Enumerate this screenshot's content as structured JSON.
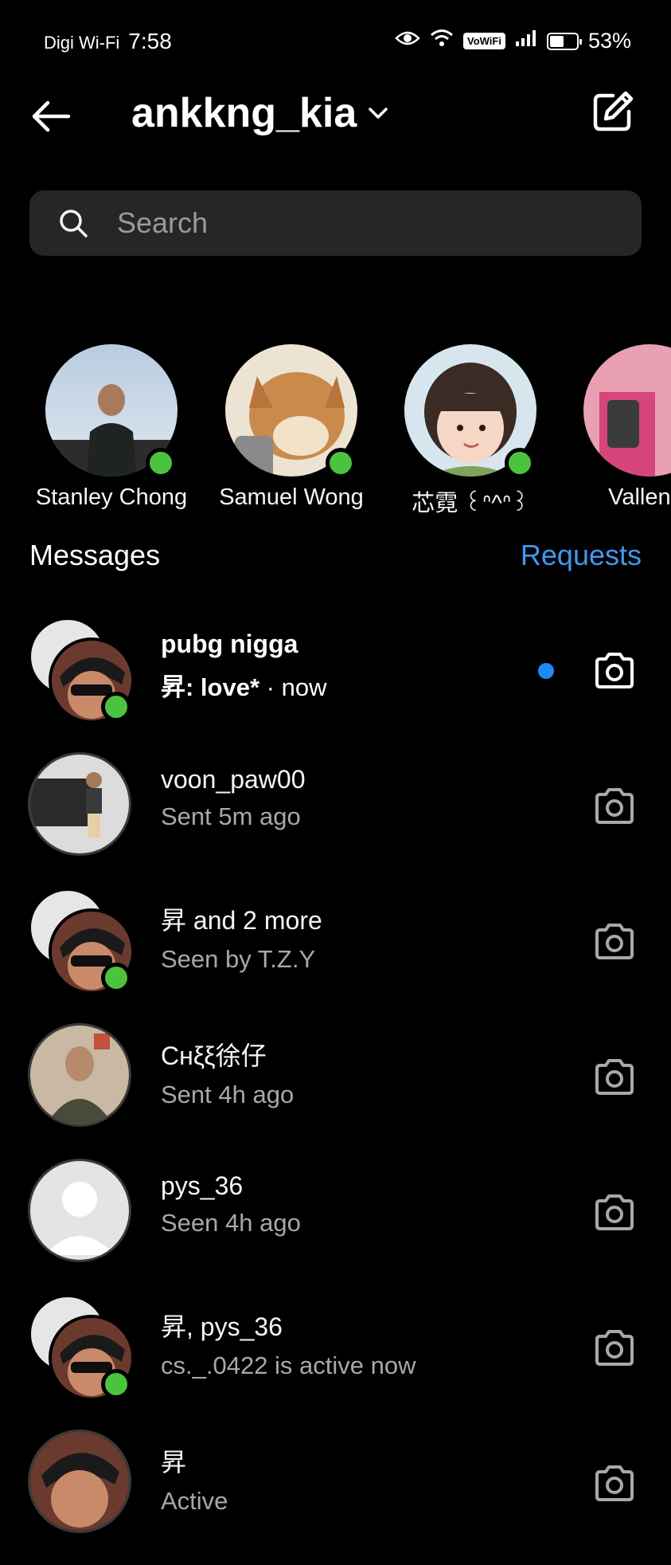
{
  "status_bar": {
    "carrier": "Digi Wi-Fi",
    "time": "7:58",
    "vowifi": "VoWiFi",
    "battery": "53%",
    "battery_level": 0.53
  },
  "header": {
    "username": "ankkng_kia"
  },
  "search": {
    "placeholder": "Search"
  },
  "stories": [
    {
      "name": "Stanley Chong",
      "online": true
    },
    {
      "name": "Samuel Wong",
      "online": true
    },
    {
      "name": "芯霓 ꒰ᐢ^ᐢ꒱",
      "online": true
    },
    {
      "name": "Vallen T",
      "online": false
    }
  ],
  "messages_label": "Messages",
  "requests_label": "Requests",
  "threads": [
    {
      "name": "pubg nigga",
      "preview": "昇: love*",
      "time": "now",
      "unread": true,
      "group": true
    },
    {
      "name": "voon_paw00",
      "preview": "Sent 5m ago",
      "group": false
    },
    {
      "name": "昇 and 2 more",
      "preview": "Seen by T.Z.Y",
      "group": true
    },
    {
      "name": "Cнξξ徐仔",
      "preview": "Sent 4h ago",
      "group": false
    },
    {
      "name": "pys_36",
      "preview": "Seen 4h ago",
      "group": false
    },
    {
      "name": "昇, pys_36",
      "preview": "cs._.0422 is active now",
      "group": true
    },
    {
      "name": "昇",
      "preview": "Active",
      "group": false
    }
  ],
  "colors": {
    "accent": "#3f98f0",
    "online": "#4cc33e",
    "unread_dot": "#1c8af5",
    "background": "#000000"
  }
}
